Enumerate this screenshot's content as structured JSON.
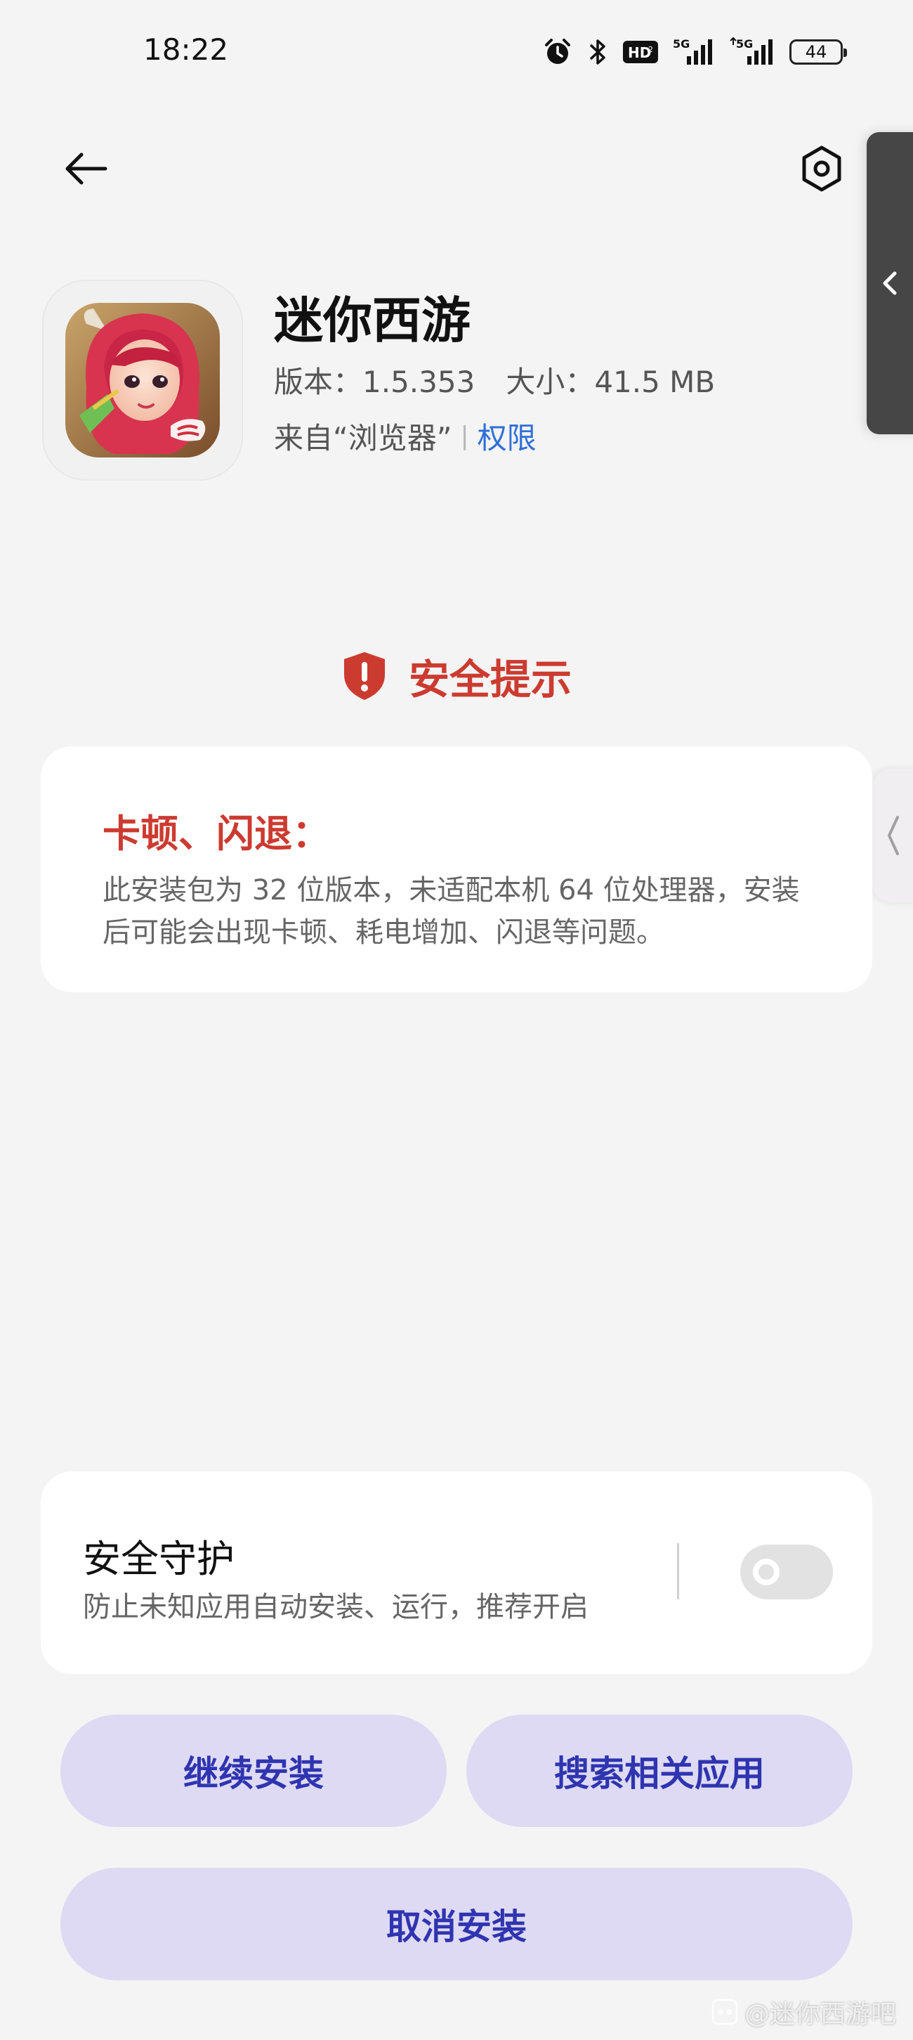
{
  "status_bar": {
    "time": "18:22",
    "hd_label": "HD",
    "signal1_label": "5G",
    "signal2_label": "5G",
    "battery": "44"
  },
  "app": {
    "name": "迷你西游",
    "version_label": "版本：1.5.353",
    "size_label": "大小：41.5 MB",
    "source_label": "来自“浏览器”",
    "separator": "|",
    "permission_link": "权限"
  },
  "security": {
    "heading": "安全提示",
    "warning_title": "卡顿、闪退：",
    "warning_body": "此安装包为 32 位版本，未适配本机 64 位处理器，安装后可能会出现卡顿、耗电增加、闪退等问题。"
  },
  "protection": {
    "title": "安全守护",
    "subtitle": "防止未知应用自动安装、运行，推荐开启",
    "enabled": false
  },
  "buttons": {
    "continue": "继续安装",
    "search": "搜索相关应用",
    "cancel": "取消安装"
  },
  "watermark": "@迷你西游吧",
  "colors": {
    "warning_red": "#cc3b30",
    "link_blue": "#2f6fd6",
    "button_bg": "#dedaf4",
    "button_text": "#2f34b0",
    "page_bg": "#f4f4f4"
  }
}
